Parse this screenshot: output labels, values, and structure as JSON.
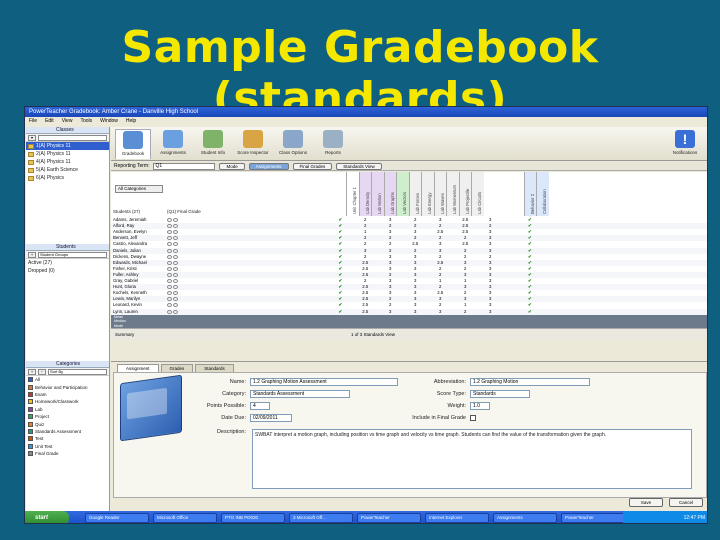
{
  "slide": {
    "title": "Sample Gradebook (standards)"
  },
  "window": {
    "title": "PowerTeacher Gradebook: Amber Crane - Danville High School",
    "menu": [
      "File",
      "Edit",
      "View",
      "Tools",
      "Window",
      "Help"
    ]
  },
  "left_pane": {
    "classes_header": "Classes",
    "classes": [
      {
        "label": "1(A) Physics 11"
      },
      {
        "label": "2(A) Physics 11"
      },
      {
        "label": "4(A) Physics 11"
      },
      {
        "label": "5(A) Earth Science"
      },
      {
        "label": "6(A) Physics"
      }
    ],
    "students_header": "Students",
    "students_filter": "Student Groups",
    "student_groups": [
      "Active (27)",
      "Dropped (0)"
    ],
    "categories_header": "Categories",
    "categories_filter": "Sort By",
    "categories": [
      {
        "label": "All",
        "color": "#2f5fcf"
      },
      {
        "label": "Behavior and Participation",
        "color": "#e07a2f"
      },
      {
        "label": "Exam",
        "color": "#c0392b"
      },
      {
        "label": "Homework/Classwork",
        "color": "#f1c40f"
      },
      {
        "label": "Lab",
        "color": "#8e44ad"
      },
      {
        "label": "Project",
        "color": "#27ae60"
      },
      {
        "label": "Quiz",
        "color": "#e67e22"
      },
      {
        "label": "Standards Assessment",
        "color": "#16a085"
      },
      {
        "label": "Test",
        "color": "#d35400"
      },
      {
        "label": "Unit Test",
        "color": "#3498db"
      },
      {
        "label": "Final Grade",
        "color": "#7f8c8d"
      }
    ]
  },
  "toolbar": {
    "buttons": [
      {
        "label": "Gradebook",
        "icon": "gradebook-icon",
        "color": "#5a8fd6"
      },
      {
        "label": "Assignments",
        "icon": "assignments-icon",
        "color": "#6aa0e0"
      },
      {
        "label": "Student Info",
        "icon": "student-info-icon",
        "color": "#7fb36a"
      },
      {
        "label": "Score Inspector",
        "icon": "score-inspector-icon",
        "color": "#d9a544"
      },
      {
        "label": "Class Options",
        "icon": "class-options-icon",
        "color": "#8aa6c8"
      },
      {
        "label": "Reports",
        "icon": "reports-icon",
        "color": "#9ab0c4"
      }
    ],
    "right_button": {
      "label": "Notifications",
      "icon": "alert-icon"
    }
  },
  "reporting_bar": {
    "label": "Reporting Term:",
    "term_value": "Q1",
    "buttons": [
      "Mode",
      "Assignments",
      "Final Grades",
      "Standards View"
    ]
  },
  "grid": {
    "filter_label": "All Categories",
    "header_col_student": "Students (27)",
    "header_col_grade": "(Q1) Final Grade",
    "assignment_headers": [
      "Unit Chapter 1",
      "Lab Density",
      "Lab Motion",
      "Lab Graphs",
      "Lab Vectors",
      "Lab Forces",
      "Lab Energy",
      "Lab Waves",
      "Lab Momentum",
      "Lab Projectile",
      "Lab Circuits",
      "Behavior 2",
      "Collaboration"
    ],
    "rows": [
      {
        "name": "Adams, Jeremiah",
        "marks": [
          "✔",
          "2",
          "3",
          "2",
          "3",
          "2.5",
          "3"
        ]
      },
      {
        "name": "Alford, Ray",
        "marks": [
          "✔",
          "2",
          "2",
          "2",
          "2",
          "2.5",
          "2"
        ]
      },
      {
        "name": "Anderson, Evelyn",
        "marks": [
          "✔",
          "1",
          "3",
          "3",
          "2.5",
          "2.5",
          "3"
        ]
      },
      {
        "name": "Bennett, Jeff",
        "marks": [
          "✔",
          "2",
          "2",
          "2",
          "2",
          "2",
          "3"
        ]
      },
      {
        "name": "Castro, Alexandra",
        "marks": [
          "✔",
          "2",
          "2",
          "2.5",
          "3",
          "2.5",
          "3"
        ]
      },
      {
        "name": "Daniels, Julian",
        "marks": [
          "✔",
          "3",
          "2",
          "2",
          "3",
          "2",
          "3"
        ]
      },
      {
        "name": "Dickens, Dwayne",
        "marks": [
          "✔",
          "2",
          "3",
          "3",
          "2",
          "2",
          "2"
        ]
      },
      {
        "name": "Edwards, Michael",
        "marks": [
          "✔",
          "2.5",
          "3",
          "3",
          "2.5",
          "3",
          "3"
        ]
      },
      {
        "name": "Fisher, Kristi",
        "marks": [
          "✔",
          "2.5",
          "3",
          "3",
          "2",
          "2",
          "3"
        ]
      },
      {
        "name": "Fuller, Ashley",
        "marks": [
          "✔",
          "2.5",
          "2",
          "3",
          "2",
          "3",
          "3"
        ]
      },
      {
        "name": "Gray, Gabriel",
        "marks": [
          "✔",
          "2",
          "3",
          "3",
          "1",
          "1",
          "3"
        ]
      },
      {
        "name": "Hunt, Gloria",
        "marks": [
          "✔",
          "2.5",
          "3",
          "3",
          "2",
          "3",
          "3"
        ]
      },
      {
        "name": "Kochels, Kenneth",
        "marks": [
          "✔",
          "2.5",
          "3",
          "3",
          "2.5",
          "2",
          "3"
        ]
      },
      {
        "name": "Lewis, Marilyn",
        "marks": [
          "✔",
          "2.5",
          "2",
          "3",
          "3",
          "3",
          "3"
        ]
      },
      {
        "name": "Leonard, Kevin",
        "marks": [
          "✔",
          "2.5",
          "2",
          "3",
          "2",
          "1",
          "3"
        ]
      },
      {
        "name": "Lynn, Lauren",
        "marks": [
          "✔",
          "2.5",
          "3",
          "3",
          "3",
          "2",
          "3"
        ]
      }
    ],
    "agg_labels": [
      "Mean",
      "Median",
      "Mode"
    ],
    "summary_label": "Summary",
    "scroll_text": "1 of 3 Standards View"
  },
  "form": {
    "tabs": [
      "Assignment",
      "Grades",
      "Standards"
    ],
    "name_label": "Name:",
    "name_value": "1.2 Graphing Motion Assessment",
    "abbrev_label": "Abbreviation:",
    "abbrev_value": "1.2 Graphing Motion",
    "category_label": "Category:",
    "category_value": "Standards Assessment",
    "score_type_label": "Score Type:",
    "score_type_value": "Standards",
    "points_label": "Points Possible:",
    "points_value": "4",
    "weight_label": "Weight:",
    "weight_value": "1.0",
    "due_label": "Date Due:",
    "due_value": "02/09/2011",
    "include_label": "Include in Final Grade",
    "desc_label": "Description:",
    "desc_value": "SWBAT interpret a motion graph, including position vs time graph and velocity vs time graph. Students can find the value of the transformation given the graph.",
    "buttons": [
      "Save",
      "Cancel"
    ]
  },
  "taskbar": {
    "start": "start",
    "items": [
      "Google Reader",
      "Microsoft Office",
      "PTG INB PD020",
      "3 Microsoft Off...",
      "PowerTeacher",
      "Internet Explorer",
      "Assignments",
      "PowerTeacher"
    ],
    "clock": "12:47 PM"
  }
}
